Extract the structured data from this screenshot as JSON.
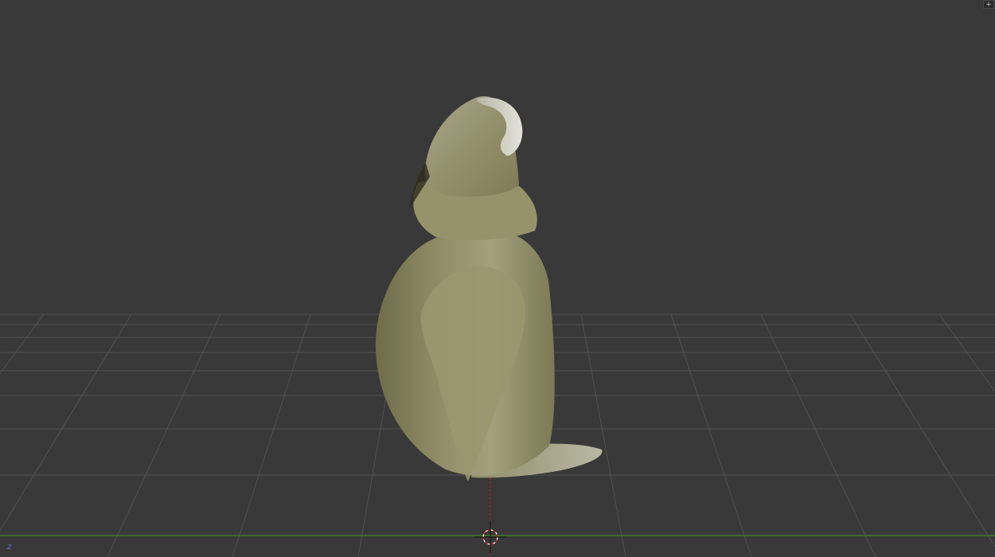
{
  "viewport": {
    "background_color": "#393939",
    "grid_color": "#555555",
    "x_axis_color": "#3f7a2a",
    "z_axis_color": "#8a2a2a",
    "model_color": "#8c8a62",
    "corner_widget_icon": "plus-icon",
    "corner_widget_glyph": "+",
    "axis_indicator_label": "z"
  }
}
